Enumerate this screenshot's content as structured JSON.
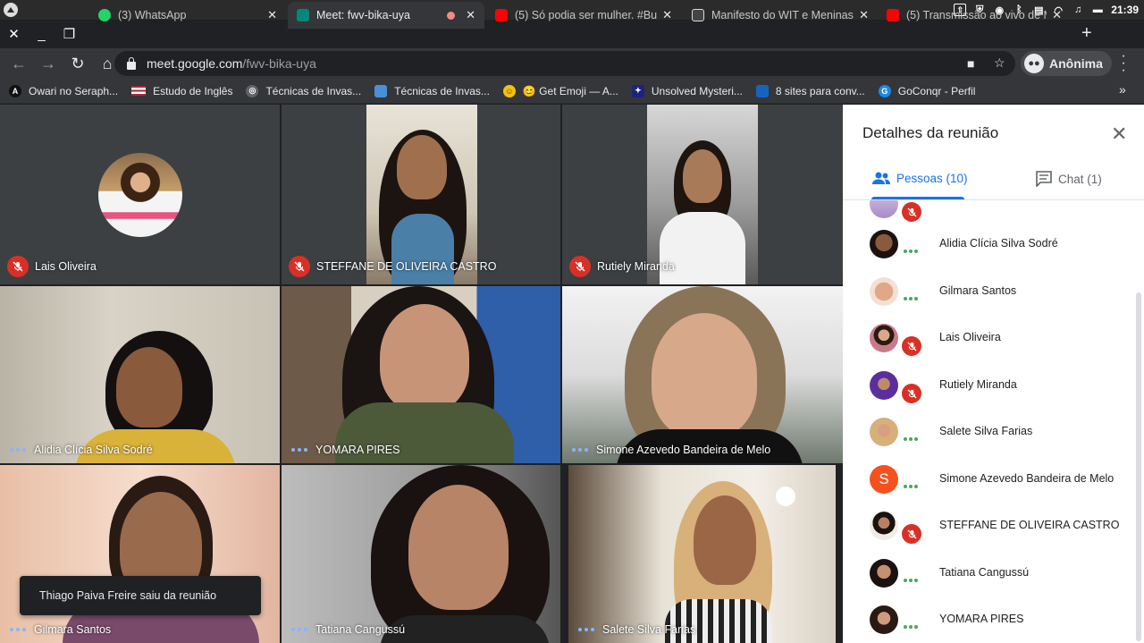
{
  "os_bar": {
    "time": "21:39"
  },
  "tabs": [
    {
      "label": "(3) WhatsApp",
      "icon": "whatsapp-icon",
      "active": false
    },
    {
      "label": "Meet: fwv-bika-uya",
      "icon": "meet-icon",
      "active": true
    },
    {
      "label": "(5) Só podia ser mulher. #Bu",
      "icon": "youtube-icon",
      "active": false
    },
    {
      "label": "Manifesto do WIT e Meninas",
      "icon": "wit-icon",
      "active": false
    },
    {
      "label": "(5) Transmissão ao vivo de M",
      "icon": "youtube-icon",
      "active": false
    }
  ],
  "toolbar": {
    "url_host": "meet.google.com",
    "url_path": "/fwv-bika-uya",
    "profile_label": "Anônima"
  },
  "bookmarks": [
    {
      "label": "Owari no Seraph...",
      "icon": "letter-a-icon",
      "color": "#ffffff"
    },
    {
      "label": "Estudo de Inglês",
      "icon": "us-flag-icon",
      "color": "#b22234"
    },
    {
      "label": "Técnicas de Invas...",
      "icon": "globe-icon",
      "color": "#e8eaed"
    },
    {
      "label": "Técnicas de Invas...",
      "icon": "laptop-icon",
      "color": "#4a90d9"
    },
    {
      "label": "😊 Get Emoji — A...",
      "icon": "emoji-icon",
      "color": "#f4c20d"
    },
    {
      "label": "Unsolved Mysteri...",
      "icon": "mystery-icon",
      "color": "#1a237e"
    },
    {
      "label": "8 sites para conv...",
      "icon": "bookmark-blue-icon",
      "color": "#1565c0"
    },
    {
      "label": "GoConqr - Perfil",
      "icon": "goconqr-icon",
      "color": "#1e88e5"
    }
  ],
  "participants_grid": [
    {
      "name": "Lais Oliveira",
      "muted": true
    },
    {
      "name": "STEFFANE DE OLIVEIRA CASTRO",
      "muted": true
    },
    {
      "name": "Rutiely Miranda",
      "muted": true
    },
    {
      "name": "Alidia Clícia Silva Sodré",
      "muted": false
    },
    {
      "name": "YOMARA PIRES",
      "muted": false
    },
    {
      "name": "Simone Azevedo Bandeira de Melo",
      "muted": false
    },
    {
      "name": "Gilmara Santos",
      "muted": false
    },
    {
      "name": "Tatiana Cangussú",
      "muted": false
    },
    {
      "name": "Salete Silva Farias",
      "muted": false
    }
  ],
  "toast": {
    "text": "Thiago Paiva Freire saiu da reunião"
  },
  "sidebar": {
    "title": "Detalhes da reunião",
    "tab_people": "Pessoas (10)",
    "tab_chat": "Chat (1)",
    "people": [
      {
        "name": "Alidia Clícia Silva Sodré",
        "muted": false
      },
      {
        "name": "Gilmara Santos",
        "muted": false
      },
      {
        "name": "Lais Oliveira",
        "muted": true
      },
      {
        "name": "Rutiely Miranda",
        "muted": true
      },
      {
        "name": "Salete Silva Farias",
        "muted": false
      },
      {
        "name": "Simone Azevedo Bandeira de Melo",
        "muted": false,
        "initial": "S"
      },
      {
        "name": "STEFFANE DE OLIVEIRA CASTRO",
        "muted": true
      },
      {
        "name": "Tatiana Cangussú",
        "muted": false
      },
      {
        "name": "YOMARA PIRES",
        "muted": false
      }
    ]
  },
  "colors": {
    "muted_red": "#d93025",
    "accent_blue": "#1a73e8",
    "speaking_green": "#34a853"
  }
}
